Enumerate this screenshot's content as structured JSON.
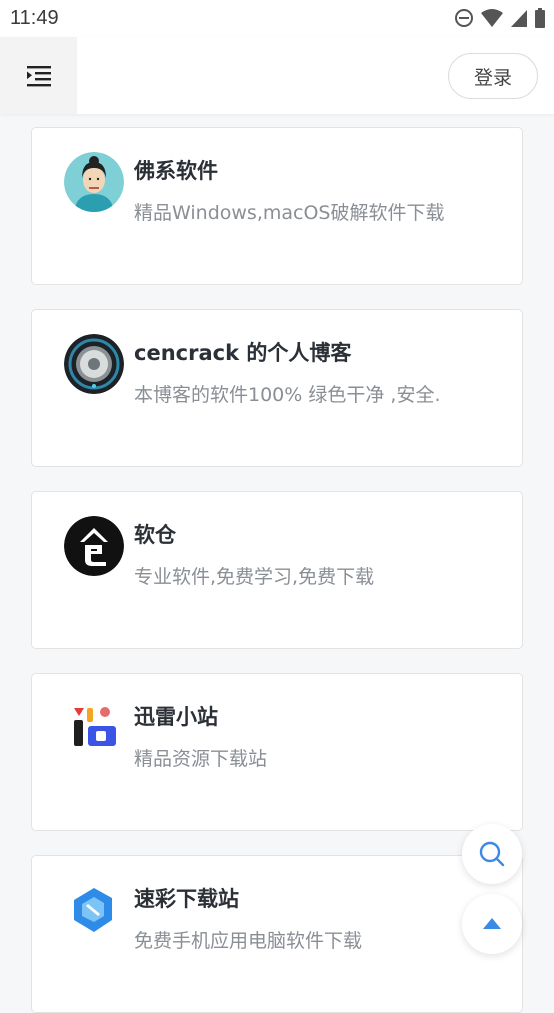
{
  "status_bar": {
    "time": "11:49",
    "icons": [
      "do-not-disturb-icon",
      "wifi-icon",
      "signal-icon",
      "battery-icon"
    ]
  },
  "header": {
    "menu_icon": "menu-indent-icon",
    "login_label": "登录"
  },
  "sites": [
    {
      "title": "佛系软件",
      "description": "精品Windows,macOS破解软件下载",
      "icon": "portrait-avatar"
    },
    {
      "title": "cencrack 的个人博客",
      "description": "本博客的软件100% 绿色干净 ,安全.",
      "icon": "knob-avatar"
    },
    {
      "title": "软仓",
      "description": "专业软件,免费学习,免费下载",
      "icon": "cang-logo"
    },
    {
      "title": "迅雷小站",
      "description": "精品资源下载站",
      "icon": "xunlei-logo"
    },
    {
      "title": "速彩下载站",
      "description": "免费手机应用电脑软件下载",
      "icon": "sucai-logo"
    }
  ],
  "fab": {
    "search_icon": "search-icon",
    "top_icon": "arrow-up-icon"
  },
  "colors": {
    "accent": "#3d8ae6",
    "title": "#2b2f36",
    "description": "#8a8f96"
  }
}
